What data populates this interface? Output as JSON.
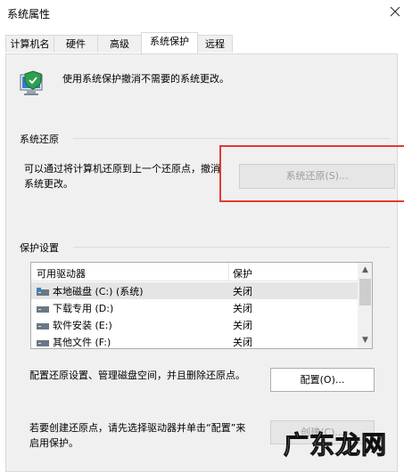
{
  "window": {
    "title": "系统属性"
  },
  "tabs": [
    {
      "label": "计算机名"
    },
    {
      "label": "硬件"
    },
    {
      "label": "高级"
    },
    {
      "label": "系统保护"
    },
    {
      "label": "远程"
    }
  ],
  "header": {
    "text": "使用系统保护撤消不需要的系统更改。"
  },
  "restore": {
    "group_title": "系统还原",
    "desc_line1": "可以通过将计算机还原到上一个还原点，撤消",
    "desc_line2": "系统更改。",
    "button_label": "系统还原(S)..."
  },
  "protection": {
    "group_title": "保护设置",
    "columns": [
      "可用驱动器",
      "保护"
    ],
    "drives": [
      {
        "name": "本地磁盘 (C:) (系统)",
        "status": "关闭"
      },
      {
        "name": "下载专用 (D:)",
        "status": "关闭"
      },
      {
        "name": "软件安装 (E:)",
        "status": "关闭"
      },
      {
        "name": "其他文件 (F:)",
        "status": "关闭"
      }
    ]
  },
  "configure": {
    "desc": "配置还原设置、管理磁盘空间，并且删除还原点。",
    "button_label": "配置(O)..."
  },
  "create": {
    "desc_line1": "若要创建还原点，请先选择驱动器并单击“配置”来",
    "desc_line2": "启用保护。",
    "button_label": "创建(C)..."
  },
  "watermark": "广东龙网",
  "colors": {
    "highlight": "#e53935",
    "panel": "#f0f0f0",
    "selected_row": "#e5e5e5"
  }
}
